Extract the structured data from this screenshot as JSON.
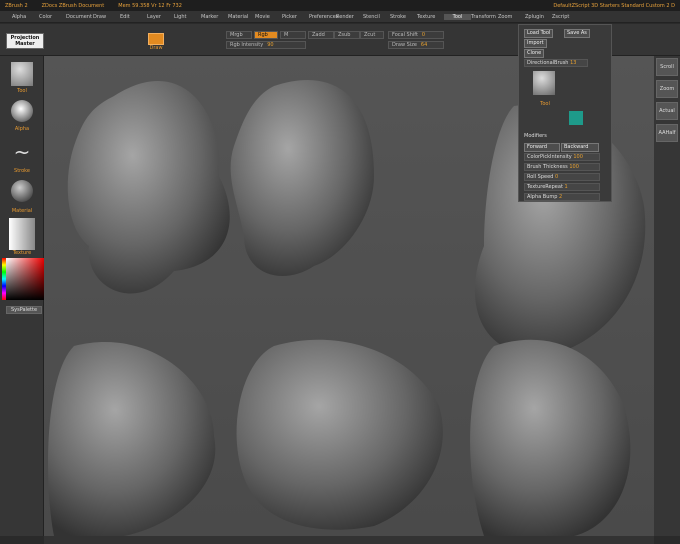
{
  "titlebar": {
    "app": "ZBrush 2",
    "doc": "ZDocs ZBrush Document",
    "mem": "Mem 59.358 Vr 12 Fr 732",
    "script": "DefaultZScript 3D Starters Standard Custom 2 D"
  },
  "menu": [
    "Alpha",
    "Color",
    "Document",
    "Draw",
    "Edit",
    "Layer",
    "Light",
    "Marker",
    "Material",
    "Movie",
    "Picker",
    "Preferences",
    "Render",
    "Stencil",
    "Stroke",
    "Texture",
    "Tool",
    "Transform",
    "Zoom",
    "Zplugin",
    "Zscript"
  ],
  "toolstrip": {
    "projection": "Projection Master",
    "draw": "Draw",
    "mrgb": "Mrgb",
    "rgb": "Rgb",
    "m": "M",
    "zadd": "Zadd",
    "zsub": "Zsub",
    "zcut": "Zcut",
    "rgb_intensity_label": "Rgb Intensity",
    "rgb_intensity": "90",
    "focal_label": "Focal Shift",
    "focal": "0",
    "drawsize_label": "Draw Size",
    "drawsize": "64"
  },
  "leftshelf": {
    "tool": "Tool",
    "alpha": "Alpha",
    "stroke": "Stroke",
    "material": "Material",
    "texture": "Texture",
    "palette": "SysPalette"
  },
  "rightshelf": [
    "Scroll",
    "Zoom",
    "Actual",
    "AAHalf"
  ],
  "toolmenu": {
    "load": "Load Tool",
    "save": "Save As",
    "import": "Import",
    "clone": "Clone",
    "directional": "DirectionalBrush",
    "directional_val": "13",
    "tool_label": "Tool",
    "modifiers": "Modifiers",
    "forward": "Forward",
    "backward": "Backward",
    "rows": [
      {
        "label": "ColorPickIntensity",
        "val": "100"
      },
      {
        "label": "Brush Thickness",
        "val": "100"
      },
      {
        "label": "Roll Speed",
        "val": "0"
      },
      {
        "label": "TextureRepeat",
        "val": "1"
      },
      {
        "label": "Alpha Bump",
        "val": "2"
      }
    ]
  }
}
